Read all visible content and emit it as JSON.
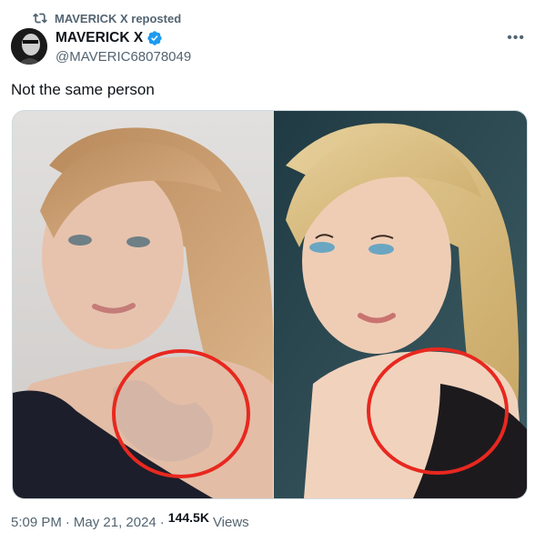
{
  "repost": {
    "label": "MAVERICK X reposted"
  },
  "author": {
    "name": "MAVERICK X",
    "handle": "@MAVERIC68078049"
  },
  "tweet": {
    "text": "Not the same person"
  },
  "meta": {
    "time": "5:09 PM",
    "date": "May 21, 2024",
    "views_count": "144.5K",
    "views_label": "Views"
  },
  "colors": {
    "verified": "#1d9bf0",
    "circle": "#e8281f",
    "muted": "#536471"
  },
  "icons": {
    "repost": "repost-icon",
    "verified": "verified-badge-icon",
    "more": "more-options-icon"
  }
}
